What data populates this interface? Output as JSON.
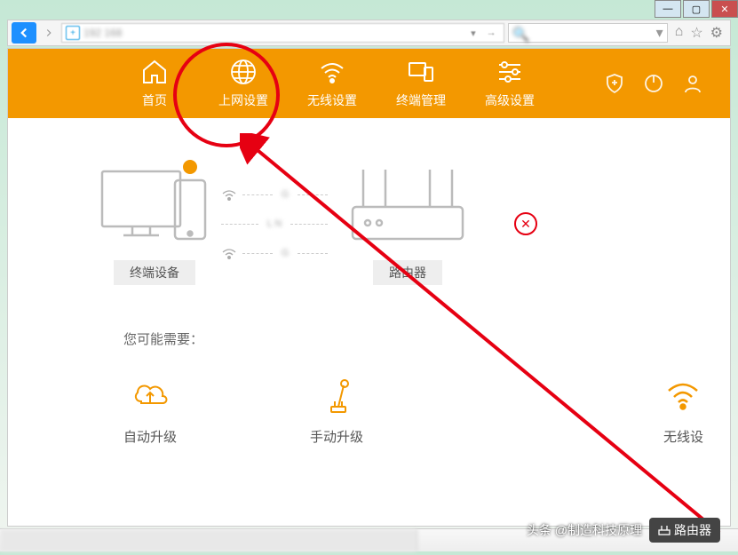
{
  "window": {
    "min": "—",
    "max": "▢",
    "close": "✕"
  },
  "nav": {
    "items": [
      {
        "label": "首页",
        "name": "home"
      },
      {
        "label": "上网设置",
        "name": "internet-settings"
      },
      {
        "label": "无线设置",
        "name": "wireless-settings"
      },
      {
        "label": "终端管理",
        "name": "device-management"
      },
      {
        "label": "高级设置",
        "name": "advanced-settings"
      }
    ]
  },
  "topology": {
    "device_label": "终端设备",
    "router_label": "路由器",
    "conn_top": "G",
    "conn_mid": "L N",
    "conn_bot": "G"
  },
  "suggestions": {
    "title": "您可能需要：",
    "items": [
      {
        "label": "自动升级",
        "name": "auto-upgrade"
      },
      {
        "label": "手动升级",
        "name": "manual-upgrade"
      },
      {
        "label": "无线设",
        "name": "wireless-partial"
      }
    ]
  },
  "watermark": {
    "attribution": "头条 @制造科技原理",
    "badge": "路由器"
  }
}
